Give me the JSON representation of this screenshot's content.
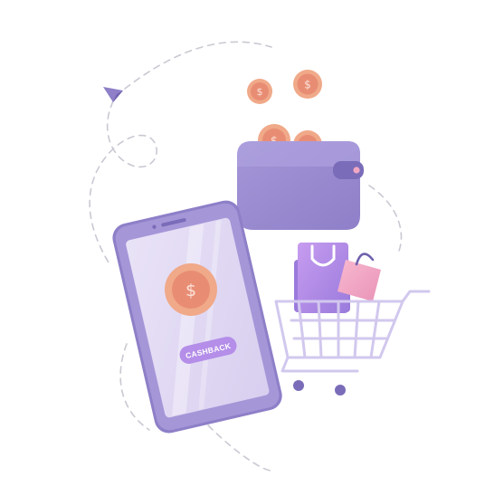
{
  "illustration": {
    "phone": {
      "button_label": "CASHBACK",
      "coin_symbol": "$"
    },
    "coins": [
      {
        "symbol": "$",
        "role": "falling-coin"
      },
      {
        "symbol": "$",
        "role": "falling-coin"
      },
      {
        "symbol": "$",
        "role": "coin-in-wallet"
      },
      {
        "symbol": "$",
        "role": "coin-in-wallet"
      }
    ],
    "icons": [
      "smartphone-icon",
      "wallet-icon",
      "coin-icon",
      "shopping-bag-icon",
      "shopping-cart-icon",
      "paper-plane-icon"
    ]
  },
  "colors": {
    "purple_dark": "#8e7fc8",
    "purple_mid": "#a899dc",
    "lavender_screen": "#e3dcf4",
    "cashback_button": "#b48ee8",
    "coin_outer": "#f0a989",
    "coin_inner": "#e88d74",
    "pink_bag": "#f1a7c4",
    "cart_line": "#cfc4ec",
    "dash_line": "#c9c9d3"
  }
}
